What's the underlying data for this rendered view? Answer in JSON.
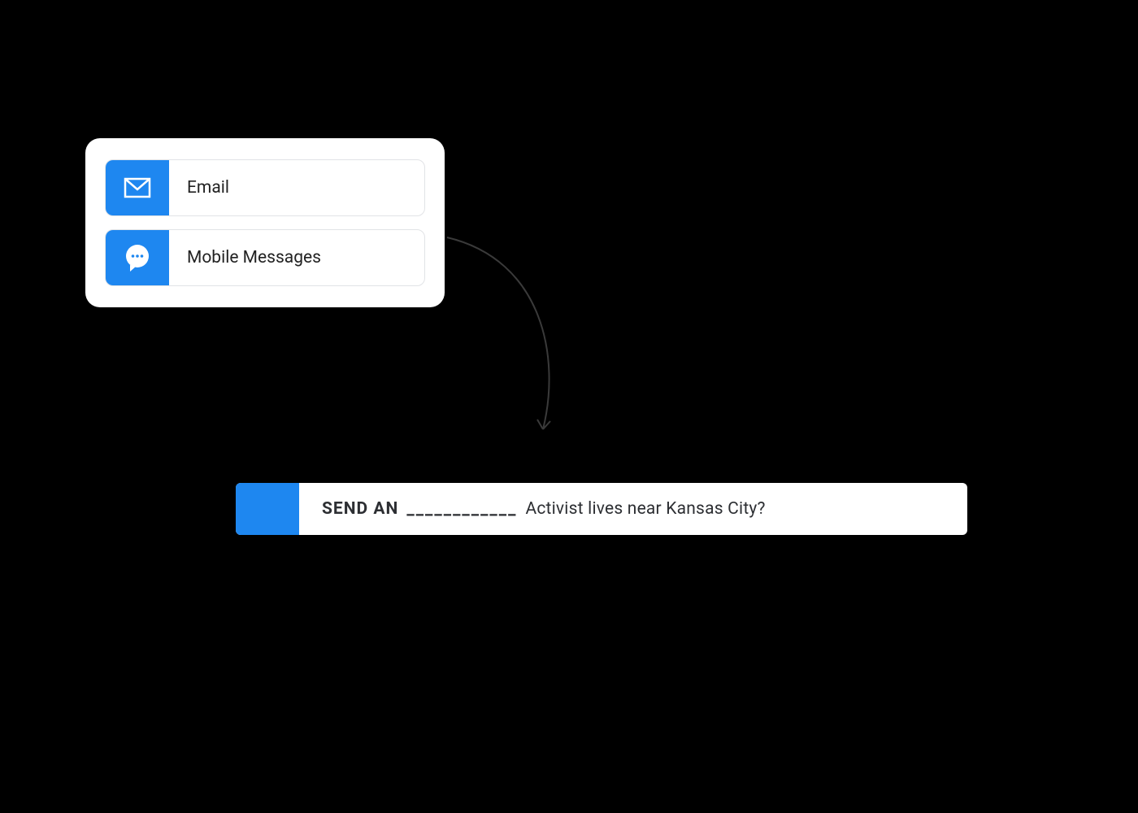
{
  "colors": {
    "accent": "#1e87f0",
    "text": "#2d2f33",
    "card_bg": "#ffffff",
    "page_bg": "#000000"
  },
  "options": {
    "items": [
      {
        "label": "Email",
        "icon": "envelope-icon"
      },
      {
        "label": "Mobile Messages",
        "icon": "chat-bubble-icon"
      }
    ]
  },
  "action": {
    "prefix": "SEND AN",
    "blank": "____________",
    "suffix": "Activist lives near Kansas City?"
  }
}
